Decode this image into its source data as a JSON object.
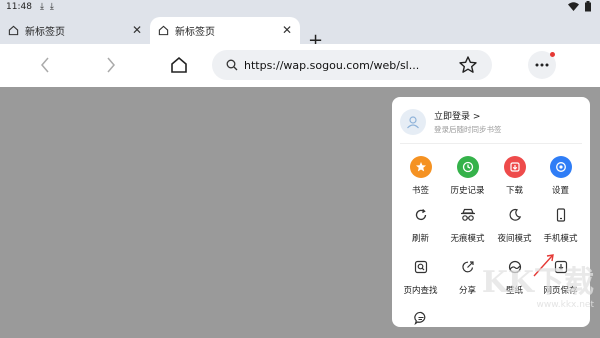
{
  "status": {
    "time": "11:48"
  },
  "tabs": [
    {
      "title": "新标签页"
    },
    {
      "title": "新标签页"
    }
  ],
  "toolbar": {
    "url": "https://wap.sogou.com/web/sl..."
  },
  "menu": {
    "login_title": "立即登录 >",
    "login_subtitle": "登录后随时同步书签",
    "items": [
      {
        "label": "书签",
        "icon": "bookmark-icon",
        "color": "#f59222"
      },
      {
        "label": "历史记录",
        "icon": "history-icon",
        "color": "#35b24a"
      },
      {
        "label": "下载",
        "icon": "download-icon",
        "color": "#ee4b4b"
      },
      {
        "label": "设置",
        "icon": "settings-icon",
        "color": "#2f7df6"
      },
      {
        "label": "刷新",
        "icon": "refresh-icon"
      },
      {
        "label": "无痕模式",
        "icon": "incognito-icon"
      },
      {
        "label": "夜间模式",
        "icon": "night-mode-icon"
      },
      {
        "label": "手机模式",
        "icon": "mobile-mode-icon"
      },
      {
        "label": "页内查找",
        "icon": "find-in-page-icon"
      },
      {
        "label": "分享",
        "icon": "share-icon"
      },
      {
        "label": "壁纸",
        "icon": "wallpaper-icon"
      },
      {
        "label": "网页保存",
        "icon": "save-page-icon"
      },
      {
        "label": "",
        "icon": "feedback-icon"
      }
    ]
  },
  "watermark": {
    "text": "KK下载",
    "url": "www.kkx.net"
  },
  "colors": {
    "accent_red": "#e53935"
  }
}
